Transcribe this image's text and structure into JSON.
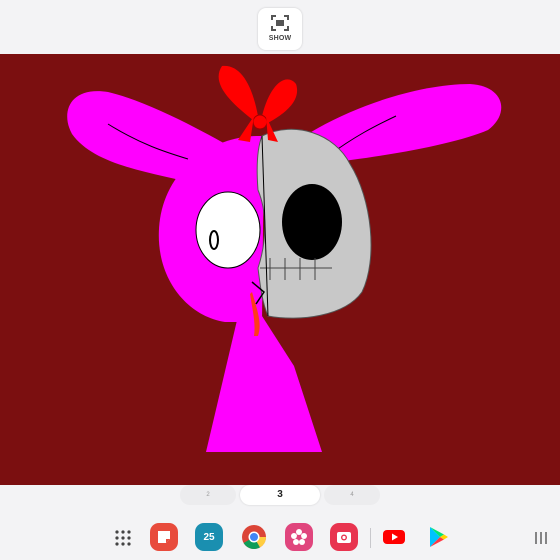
{
  "toolbar": {
    "show_label": "SHOW"
  },
  "canvas": {
    "background": "#7b0f10"
  },
  "pages": {
    "previous": "2",
    "current": "3",
    "next": "4"
  },
  "dock": {
    "calendar_day": "25",
    "apps": [
      {
        "name": "app-drawer-icon"
      },
      {
        "name": "notes-app-icon",
        "color": "#e84b3c"
      },
      {
        "name": "calendar-app-icon",
        "color": "#1a8fb0"
      },
      {
        "name": "chrome-app-icon"
      },
      {
        "name": "gallery-app-icon",
        "color": "#e0457d"
      },
      {
        "name": "camera-app-icon",
        "color": "#e8344f"
      },
      {
        "name": "youtube-app-icon",
        "color": "#ff0000"
      },
      {
        "name": "play-store-app-icon"
      }
    ]
  }
}
